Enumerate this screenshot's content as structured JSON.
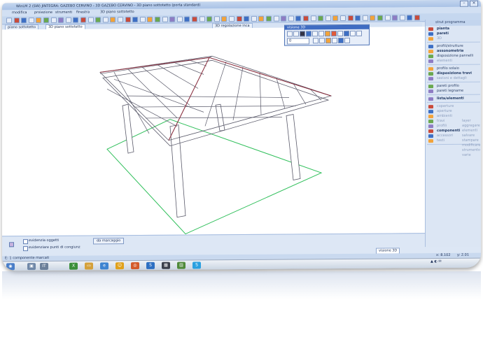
{
  "window": {
    "title": "WinLM 2 (SW) JINTEGRA: GAZEBO CERVINO - 3D GAZEBO CERVINO - 3D piano sottotetto (porta standard)"
  },
  "menu": {
    "items": [
      "modifica",
      "proiezione",
      "strumenti",
      "finestra"
    ],
    "view_tab_label": "3D piano sottotetto"
  },
  "tabs": [
    "piano sottotetto",
    "3D piano sottotetto"
  ],
  "view_label": "3D regolazione inca",
  "float_panel": {
    "title": "visione 3D",
    "field_value": "0",
    "icon_names": [
      "home-icon",
      "eye-icon",
      "cube-icon",
      "rotate-icon",
      "zoom-icon",
      "pan-icon",
      "layers-icon",
      "light-icon",
      "camera-icon",
      "grid-icon",
      "cut-icon",
      "print-icon"
    ]
  },
  "right_panel": {
    "header": "strut programma",
    "groups": [
      {
        "items": [
          {
            "label": "pianta",
            "style": "bold"
          },
          {
            "label": "pareti",
            "style": "bold"
          },
          {
            "label": "3D",
            "style": "dim"
          }
        ]
      },
      {
        "items": [
          {
            "label": "profili/strutture",
            "style": "normal"
          },
          {
            "label": "assonometria",
            "style": "bold"
          },
          {
            "label": "disposizione pannelli",
            "style": "normal"
          },
          {
            "label": "elementi",
            "style": "dim"
          }
        ]
      },
      {
        "items": [
          {
            "label": "profilo solaio",
            "style": "normal"
          },
          {
            "label": "disposizione travi",
            "style": "bold"
          },
          {
            "label": "sezioni e dettagli",
            "style": "dim"
          }
        ]
      },
      {
        "items": [
          {
            "label": "pareti profilo",
            "style": "normal"
          },
          {
            "label": "pareti legname",
            "style": "normal"
          }
        ]
      },
      {
        "items": [
          {
            "label": "lista/elementi",
            "style": "bold"
          }
        ]
      },
      {
        "items": [
          {
            "label": "coperture",
            "style": "dim"
          },
          {
            "label": "aperture",
            "style": "dim"
          },
          {
            "label": "ambienti",
            "style": "dim"
          },
          {
            "label": "travi",
            "style": "dim"
          },
          {
            "label": "profili",
            "style": "dim"
          },
          {
            "label": "componenti",
            "style": "bold"
          },
          {
            "label": "accessori",
            "style": "dim"
          },
          {
            "label": "testi",
            "style": "dim"
          }
        ]
      }
    ],
    "right_col": [
      "layer",
      "aggregare",
      "elementi",
      "salvare",
      "stampare",
      "modificare",
      "strumento",
      "varie"
    ]
  },
  "bottom_panel": {
    "checkbox1_label": "evidenzia oggetti",
    "button_label": "da marcaggio",
    "checkbox2_label": "evidenziare punti di congiunz",
    "search_label": "visione 3D"
  },
  "status": {
    "left": "E: 1 componente marcati",
    "coords": [
      "x: 8.102",
      "y: 2.01"
    ]
  },
  "taskbar": {
    "items": [
      "start",
      "explorer",
      "ie",
      "office",
      "chrome",
      "media",
      "skype-blue",
      "app1",
      "app2",
      "skype"
    ],
    "lang": "IT"
  },
  "colors": {
    "chrome_blue": "#c5d7ef",
    "panel_bg": "#dce6f4",
    "structure_stroke": "#5a5a6a",
    "ridge_stroke": "#8b2c3c",
    "ground_line": "#2fbf5a"
  }
}
